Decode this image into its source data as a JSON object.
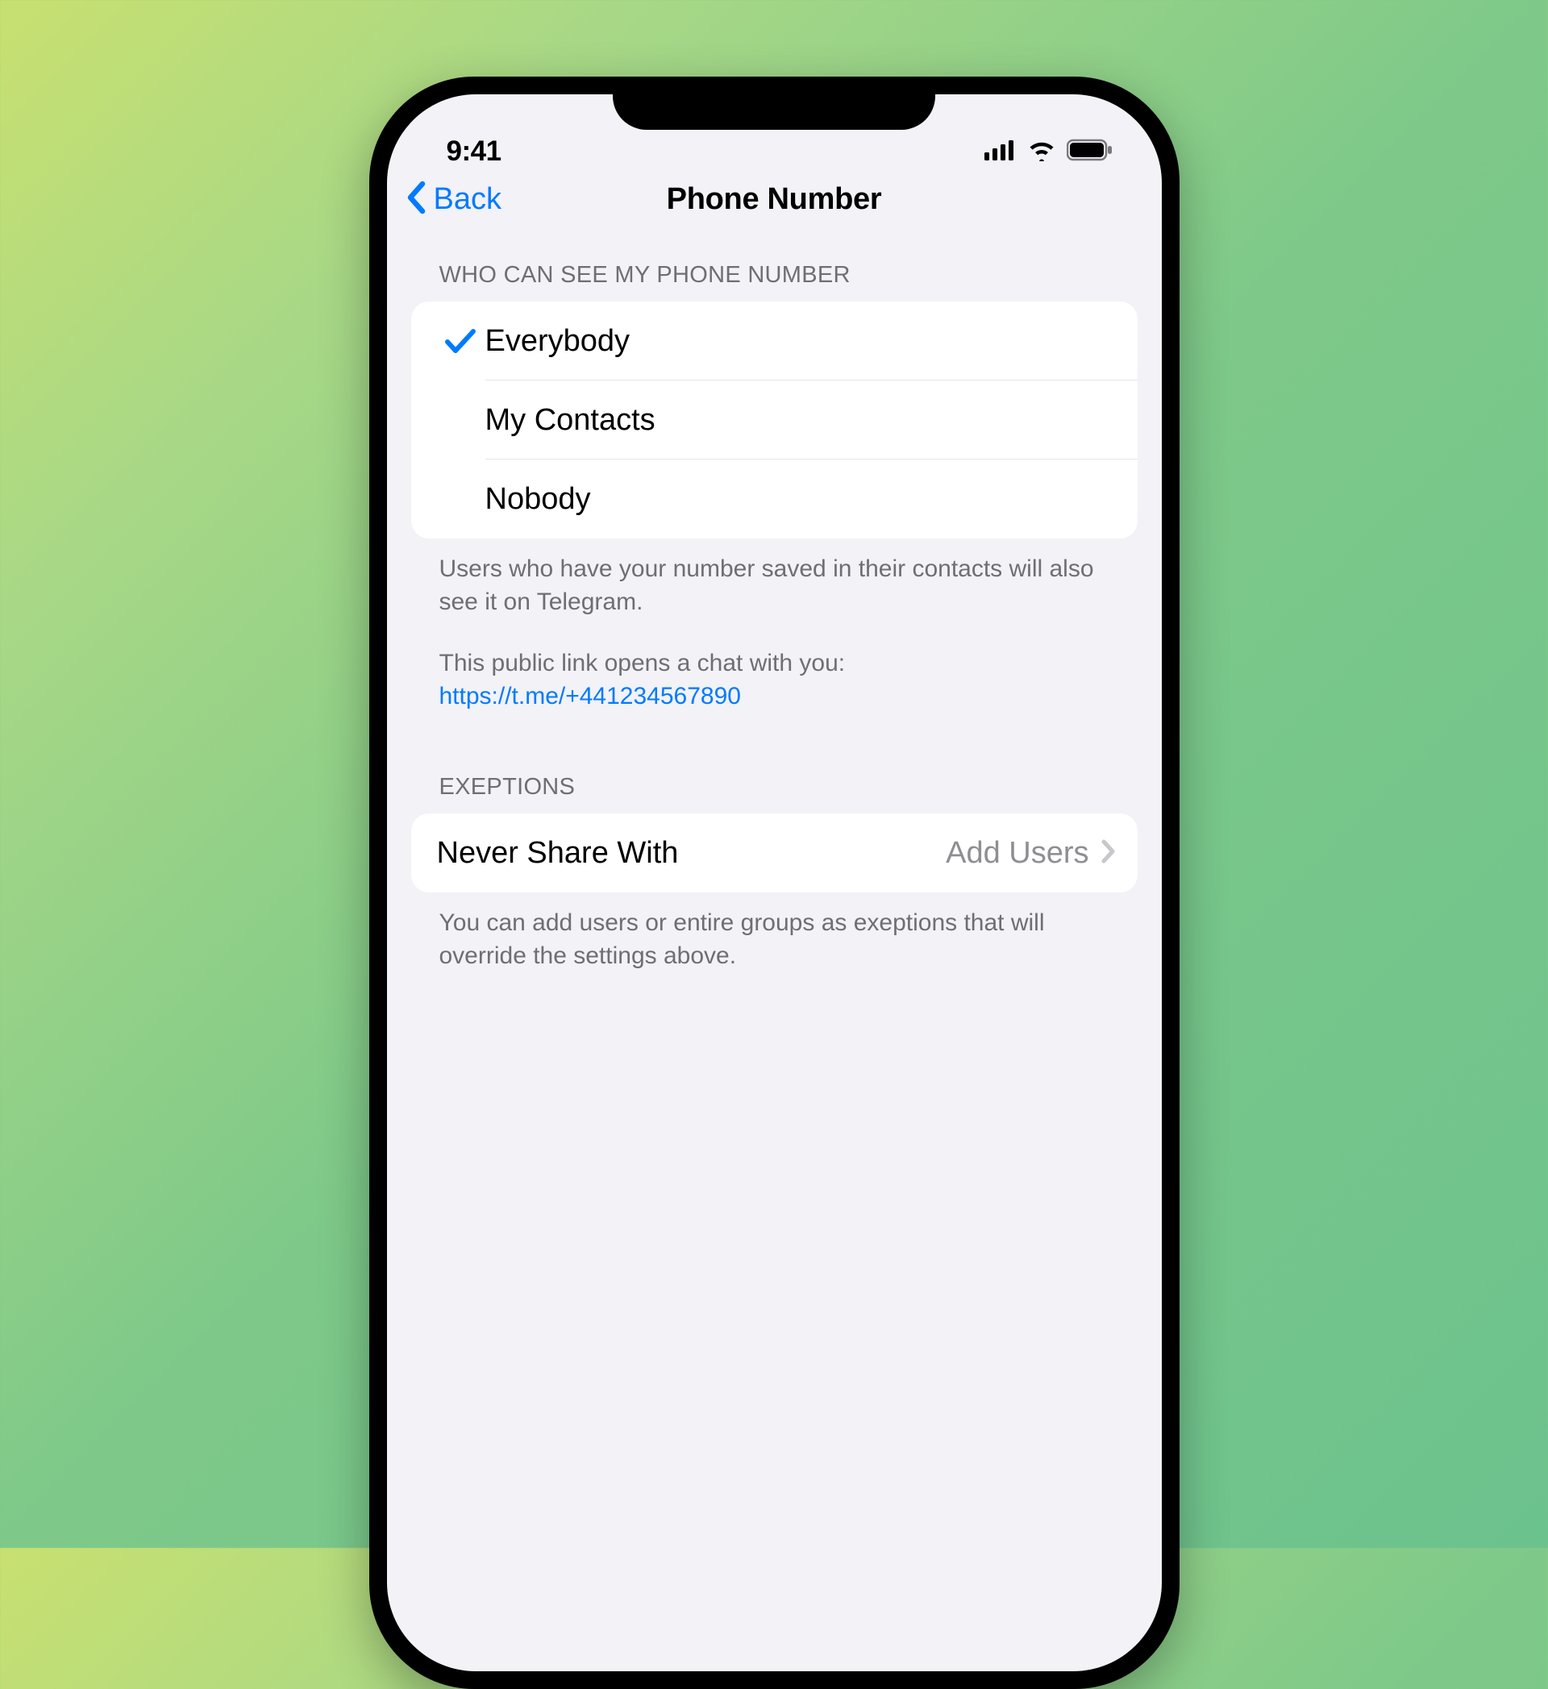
{
  "statusBar": {
    "time": "9:41"
  },
  "nav": {
    "back": "Back",
    "title": "Phone Number"
  },
  "section1": {
    "header": "WHO CAN SEE MY PHONE NUMBER",
    "options": [
      {
        "label": "Everybody",
        "checked": true
      },
      {
        "label": "My Contacts",
        "checked": false
      },
      {
        "label": "Nobody",
        "checked": false
      }
    ],
    "footer1": "Users who have your number saved in their contacts will also see it on Telegram.",
    "footer2": "This public link opens a chat with you:",
    "link": "https://t.me/+441234567890"
  },
  "section2": {
    "header": "EXEPTIONS",
    "rowLabel": "Never Share With",
    "rowValue": "Add Users",
    "footer": "You can add users or entire groups as exeptions that will override the settings above."
  }
}
